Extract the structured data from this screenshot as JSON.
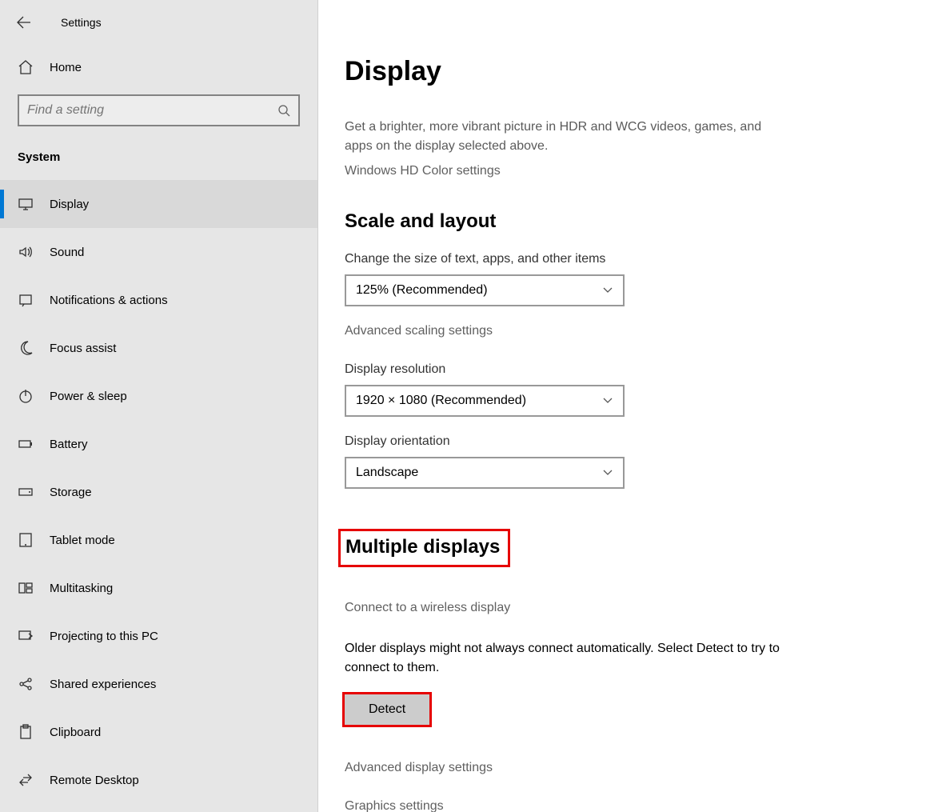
{
  "window": {
    "title": "Settings"
  },
  "sidebar": {
    "home_label": "Home",
    "search_placeholder": "Find a setting",
    "category_label": "System",
    "items": [
      {
        "label": "Display",
        "icon": "display-icon",
        "selected": true
      },
      {
        "label": "Sound",
        "icon": "sound-icon"
      },
      {
        "label": "Notifications & actions",
        "icon": "notification-icon"
      },
      {
        "label": "Focus assist",
        "icon": "moon-icon"
      },
      {
        "label": "Power & sleep",
        "icon": "power-icon"
      },
      {
        "label": "Battery",
        "icon": "battery-icon"
      },
      {
        "label": "Storage",
        "icon": "storage-icon"
      },
      {
        "label": "Tablet mode",
        "icon": "tablet-icon"
      },
      {
        "label": "Multitasking",
        "icon": "multitask-icon"
      },
      {
        "label": "Projecting to this PC",
        "icon": "project-icon"
      },
      {
        "label": "Shared experiences",
        "icon": "share-icon"
      },
      {
        "label": "Clipboard",
        "icon": "clipboard-icon"
      },
      {
        "label": "Remote Desktop",
        "icon": "remote-icon"
      }
    ]
  },
  "main": {
    "page_title": "Display",
    "hdr_desc": "Get a brighter, more vibrant picture in HDR and WCG videos, games, and apps on the display selected above.",
    "hdr_link": "Windows HD Color settings",
    "section_scale": "Scale and layout",
    "scale_label": "Change the size of text, apps, and other items",
    "scale_value": "125% (Recommended)",
    "advanced_scaling": "Advanced scaling settings",
    "resolution_label": "Display resolution",
    "resolution_value": "1920 × 1080 (Recommended)",
    "orientation_label": "Display orientation",
    "orientation_value": "Landscape",
    "section_multi": "Multiple displays",
    "wireless_link": "Connect to a wireless display",
    "detect_desc": "Older displays might not always connect automatically. Select Detect to try to connect to them.",
    "detect_button": "Detect",
    "adv_display": "Advanced display settings",
    "graphics": "Graphics settings"
  }
}
